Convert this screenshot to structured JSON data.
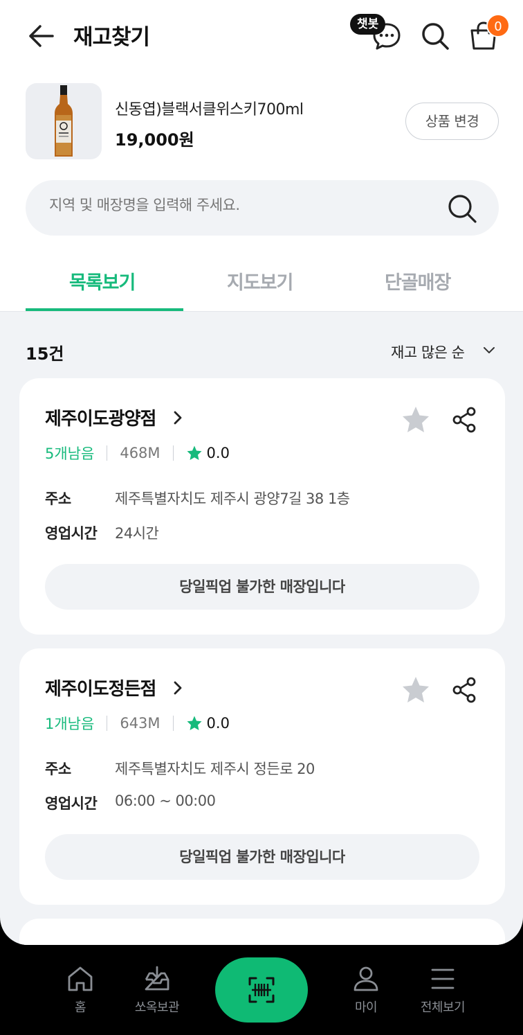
{
  "header": {
    "title": "재고찾기",
    "chat_badge": "챗봇",
    "cart_count": "0"
  },
  "product": {
    "name": "신동엽)블랙서클위스키700ml",
    "price": "19,000원",
    "change_label": "상품 변경"
  },
  "search": {
    "placeholder": "지역 및 매장명을 입력해 주세요."
  },
  "tabs": [
    {
      "label": "목록보기",
      "active": true
    },
    {
      "label": "지도보기",
      "active": false
    },
    {
      "label": "단골매장",
      "active": false
    }
  ],
  "list": {
    "count": "15건",
    "sort_label": "재고 많은 순"
  },
  "stores": [
    {
      "name": "제주이도광양점",
      "stock": "5개남음",
      "distance": "468M",
      "rating": "0.0",
      "address_label": "주소",
      "address": "제주특별자치도 제주시 광양7길 38 1층",
      "hours_label": "영업시간",
      "hours": "24시간",
      "pickup": "당일픽업 불가한 매장입니다"
    },
    {
      "name": "제주이도정든점",
      "stock": "1개남음",
      "distance": "643M",
      "rating": "0.0",
      "address_label": "주소",
      "address": "제주특별자치도 제주시 정든로 20",
      "hours_label": "영업시간",
      "hours": "06:00 ~ 00:00",
      "pickup": "당일픽업 불가한 매장입니다"
    }
  ],
  "bottom_nav": [
    {
      "label": "홈",
      "icon": "home-icon"
    },
    {
      "label": "쏘옥보관",
      "icon": "storage-box-icon"
    },
    {
      "label": "",
      "icon": "barcode-scan-icon"
    },
    {
      "label": "마이",
      "icon": "person-icon"
    },
    {
      "label": "전체보기",
      "icon": "menu-icon"
    }
  ],
  "colors": {
    "accent": "#17ba7c",
    "badge": "#ff6a13",
    "background": "#f1f3f6",
    "star_gray": "#c9ccd1"
  }
}
